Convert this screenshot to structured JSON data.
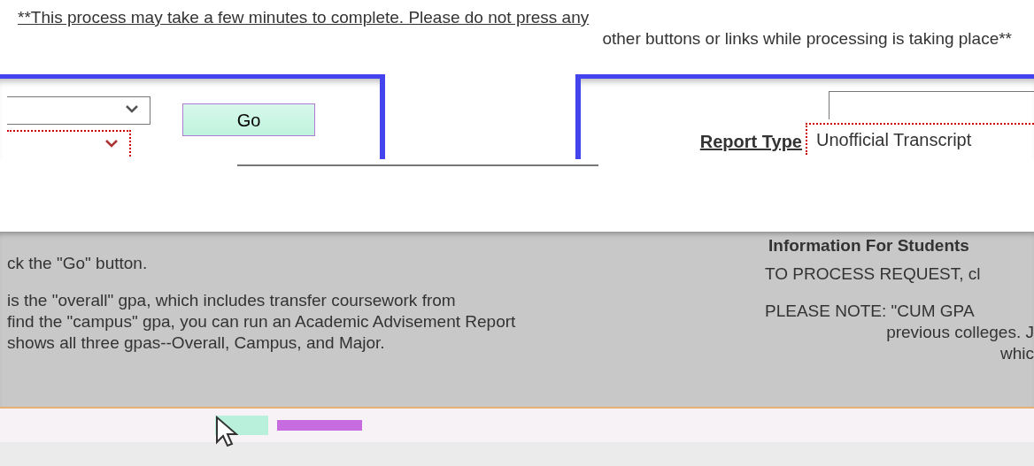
{
  "notice": {
    "line_1": "**This process may take a few minutes to complete. Please do not press any",
    "line_2": "other buttons or links while processing is taking place**"
  },
  "left_panel": {
    "go_button": "Go"
  },
  "right_panel": {
    "report_type_label": "Report Type",
    "report_type_value": "Unofficial Transcript"
  },
  "info": {
    "heading": "Information For Students",
    "left_lines": [
      "ck the \"Go\" button.",
      "is the \"overall\" gpa, which includes transfer coursework from",
      "find the \"campus\" gpa, you can run an Academic Advisement Report",
      "shows all three gpas--Overall, Campus, and Major."
    ],
    "right_lines": [
      "TO PROCESS REQUEST, cl",
      "PLEASE NOTE:  \"CUM GPA",
      "previous colleges. J",
      "whic"
    ]
  }
}
